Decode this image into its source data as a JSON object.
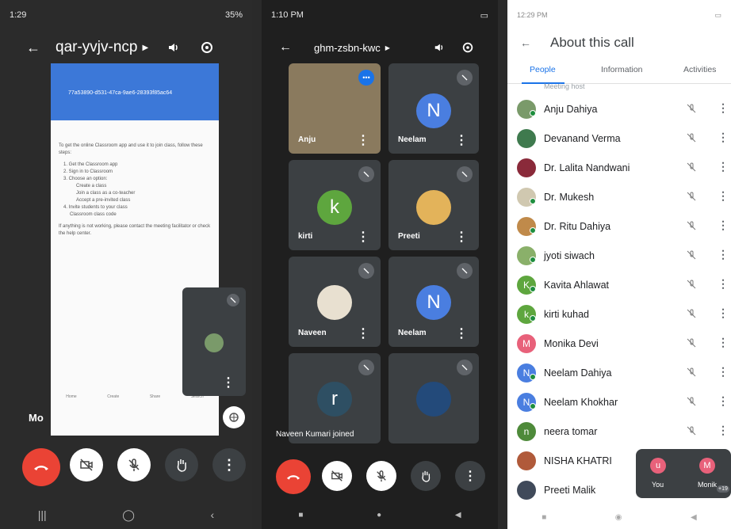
{
  "panel1": {
    "status_time": "1:29",
    "status_battery": "35%",
    "meeting_code": "qar-yvjv-ncp",
    "doc": {
      "title": "77a53890-d531-47ca-9ae6-28393f85ac64",
      "intro": "To get the online Classroom app and use it to join class, follow these steps:",
      "steps": [
        "1. Get the Classroom app",
        "2. Sign in to Classroom",
        "3. Choose an option:",
        "Create a class",
        "Join a class as a co-teacher",
        "Accept a pre-invited class",
        "4. Invite students to your class",
        "Classroom class code"
      ],
      "outro": "If anything is not working, please contact the meeting facilitator or check the help center.",
      "bottom_tabs": [
        "Home",
        "Create",
        "Share",
        "Search"
      ]
    },
    "presenter_label": "Mo"
  },
  "panel2": {
    "status_time": "1:10 PM",
    "meeting_code": "ghm-zsbn-kwc",
    "tiles": [
      {
        "name": "Anju",
        "initial": "",
        "color": "#8a7a5e"
      },
      {
        "name": "Neelam",
        "initial": "N",
        "color": "#4a7ee0"
      },
      {
        "name": "kirti",
        "initial": "k",
        "color": "#5ea63e"
      },
      {
        "name": "Preeti",
        "initial": "",
        "color": "#e3b35a"
      },
      {
        "name": "Naveen",
        "initial": "",
        "color": "#e8e0d0"
      },
      {
        "name": "Neelam",
        "initial": "N",
        "color": "#4a7ee0"
      },
      {
        "name": "",
        "initial": "r",
        "color": "#2e4f63"
      },
      {
        "name": "",
        "initial": "",
        "color": "#234a7a"
      }
    ],
    "toast": "Naveen Kumari joined"
  },
  "panel3": {
    "status_time": "12:29 PM",
    "title": "About this call",
    "tabs": [
      "People",
      "Information",
      "Activities"
    ],
    "partial_row": "Meeting host",
    "people": [
      {
        "name": "Anju Dahiya",
        "initial": "",
        "color": "#7a9a6a"
      },
      {
        "name": "Devanand Verma",
        "initial": "",
        "color": "#3f7a4e"
      },
      {
        "name": "Dr. Lalita Nandwani",
        "initial": "",
        "color": "#8a2a3a"
      },
      {
        "name": "Dr. Mukesh",
        "initial": "",
        "color": "#d0c8b0"
      },
      {
        "name": "Dr. Ritu Dahiya",
        "initial": "",
        "color": "#c08a4a"
      },
      {
        "name": "jyoti siwach",
        "initial": "",
        "color": "#8ab06a"
      },
      {
        "name": "Kavita Ahlawat",
        "initial": "K",
        "color": "#5ea63e"
      },
      {
        "name": "kirti kuhad",
        "initial": "k",
        "color": "#5ea63e"
      },
      {
        "name": "Monika Devi",
        "initial": "M",
        "color": "#e8617a"
      },
      {
        "name": "Neelam Dahiya",
        "initial": "N",
        "color": "#4a7ee0"
      },
      {
        "name": "Neelam Khokhar",
        "initial": "N",
        "color": "#4a7ee0"
      },
      {
        "name": "neera tomar",
        "initial": "n",
        "color": "#4e8a3a"
      },
      {
        "name": "NISHA KHATRI",
        "initial": "",
        "color": "#b05a3a"
      },
      {
        "name": "Preeti Malik",
        "initial": "",
        "color": "#404a5a"
      }
    ],
    "pip": {
      "you_label": "You",
      "you_initial": "u",
      "moni_label": "Monik",
      "moni_initial": "M",
      "extra": "+19"
    }
  },
  "colors": {
    "hangup": "#ea4335",
    "blue": "#1a73e8",
    "dark": "#202124"
  }
}
